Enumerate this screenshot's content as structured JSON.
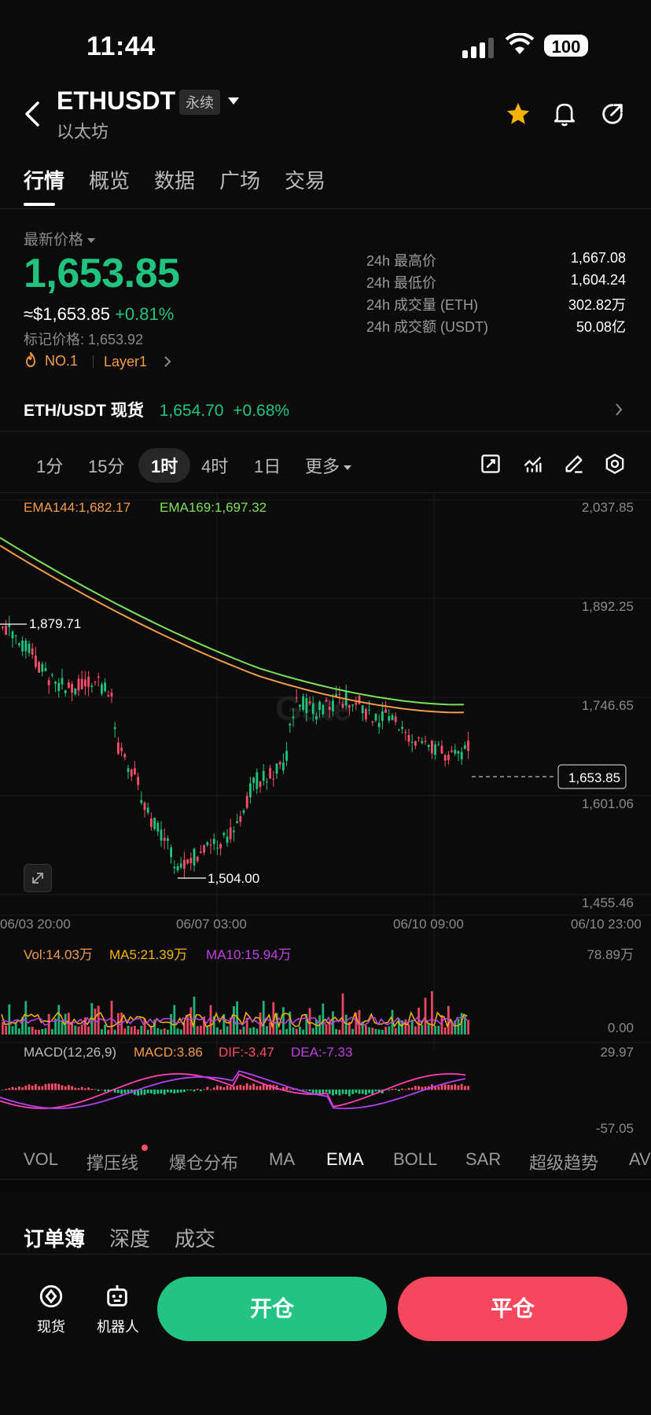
{
  "status_bar": {
    "time": "11:44",
    "battery": "100"
  },
  "header": {
    "symbol": "ETHUSDT",
    "contract_type": "永续",
    "coin_name": "以太坊"
  },
  "tabs": [
    "行情",
    "概览",
    "数据",
    "广场",
    "交易"
  ],
  "price": {
    "label": "最新价格",
    "last": "1,653.85",
    "approx_usd": "≈$1,653.85",
    "change": "+0.81%",
    "mark_price": "标记价格: 1,653.92",
    "tag_rank": "NO.1",
    "tag_sector": "Layer1"
  },
  "stats": [
    {
      "label": "24h 最高价",
      "value": "1,667.08"
    },
    {
      "label": "24h 最低价",
      "value": "1,604.24"
    },
    {
      "label": "24h 成交量 (ETH)",
      "value": "302.82万"
    },
    {
      "label": "24h 成交额 (USDT)",
      "value": "50.08亿"
    }
  ],
  "spot": {
    "pair": "ETH/USDT 现货",
    "price": "1,654.70",
    "change": "+0.68%"
  },
  "intervals": [
    "1分",
    "15分",
    "1时",
    "4时",
    "1日",
    "更多"
  ],
  "chart": {
    "ema144": "EMA144:1,682.17",
    "ema169": "EMA169:1,697.32",
    "y_labels": [
      "2,037.85",
      "1,892.25",
      "1,746.65",
      "1,601.06",
      "1,455.46"
    ],
    "current_price": "1,653.85",
    "high_marker": "1,879.71",
    "low_marker": "1,504.00",
    "x_labels": [
      "06/03 20:00",
      "06/07 03:00",
      "06/10 09:00",
      "06/10 23:00"
    ],
    "vol": "Vol:14.03万",
    "ma5": "MA5:21.39万",
    "ma10": "MA10:15.94万",
    "vol_max": "78.89万",
    "vol_min": "0.00",
    "macd_title": "MACD(12,26,9)",
    "macd": "MACD:3.86",
    "dif": "DIF:-3.47",
    "dea": "DEA:-7.33",
    "macd_max": "29.97",
    "macd_min": "-57.05",
    "watermark": "Gate",
    "colors": {
      "up": "#21c47e",
      "down": "#ff4d6a",
      "ema144": "#f29b4b",
      "ema169": "#7ee05a"
    }
  },
  "indicators": [
    "VOL",
    "撑压线",
    "爆仓分布",
    "MA",
    "EMA",
    "BOLL",
    "SAR",
    "超级趋势",
    "AV"
  ],
  "orderbook_tabs": [
    "订单簿",
    "深度",
    "成交"
  ],
  "bottom": {
    "spot_label": "现货",
    "bot_label": "机器人",
    "open": "开仓",
    "close": "平仓"
  }
}
